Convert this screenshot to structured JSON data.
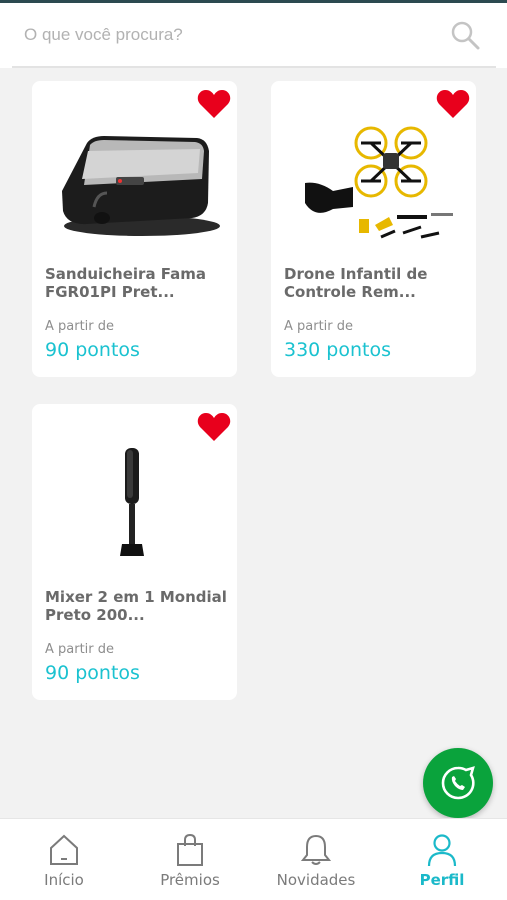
{
  "search": {
    "placeholder": "O que você procura?"
  },
  "products": [
    {
      "title": "Sanduicheira Fama FGR01PI Pret...",
      "from_label": "A partir de",
      "price": "90 pontos",
      "favorite": true,
      "image_icon": "sandwich-maker"
    },
    {
      "title": "Drone Infantil de Controle Rem...",
      "from_label": "A partir de",
      "price": "330 pontos",
      "favorite": true,
      "image_icon": "drone"
    },
    {
      "title": "Mixer 2 em 1 Mondial Preto 200...",
      "from_label": "A partir de",
      "price": "90 pontos",
      "favorite": true,
      "image_icon": "hand-mixer"
    }
  ],
  "nav": {
    "items": [
      {
        "label": "Início",
        "icon": "home-icon"
      },
      {
        "label": "Prêmios",
        "icon": "shopping-bag-icon"
      },
      {
        "label": "Novidades",
        "icon": "bell-icon"
      },
      {
        "label": "Perfil",
        "icon": "user-icon"
      }
    ],
    "active": "Perfil"
  },
  "colors": {
    "accent": "#1bc2d0",
    "heart": "#e8001c",
    "whatsapp": "#0aa33c"
  }
}
